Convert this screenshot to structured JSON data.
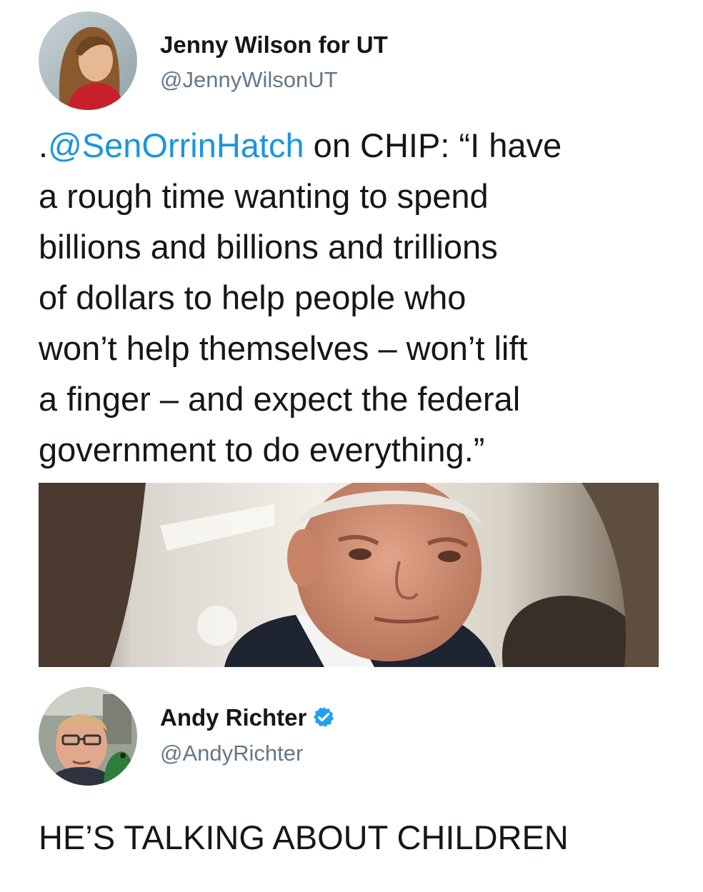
{
  "tweet1": {
    "display_name": "Jenny Wilson for UT",
    "handle": "@JennyWilsonUT",
    "avatar_icon": "profile-photo-woman",
    "text_prefix": ".",
    "mention": "@SenOrrinHatch",
    "lines": [
      " on CHIP: “I have",
      "a rough time wanting to spend",
      "billions and billions and trillions",
      "of dollars to help people who",
      "won’t help themselves – won’t lift",
      "a finger – and expect the federal",
      "government to do everything.”"
    ],
    "media_icon": "photo-older-man-in-hallway"
  },
  "tweet2": {
    "display_name": "Andy Richter",
    "verified_icon": "verified-badge-icon",
    "handle": "@AndyRichter",
    "avatar_icon": "profile-photo-man-with-parrot",
    "text": "HE’S TALKING ABOUT CHILDREN"
  },
  "colors": {
    "mention": "#1b95e0",
    "handle": "#657786",
    "text": "#14171a",
    "verified": "#1da1f2"
  }
}
